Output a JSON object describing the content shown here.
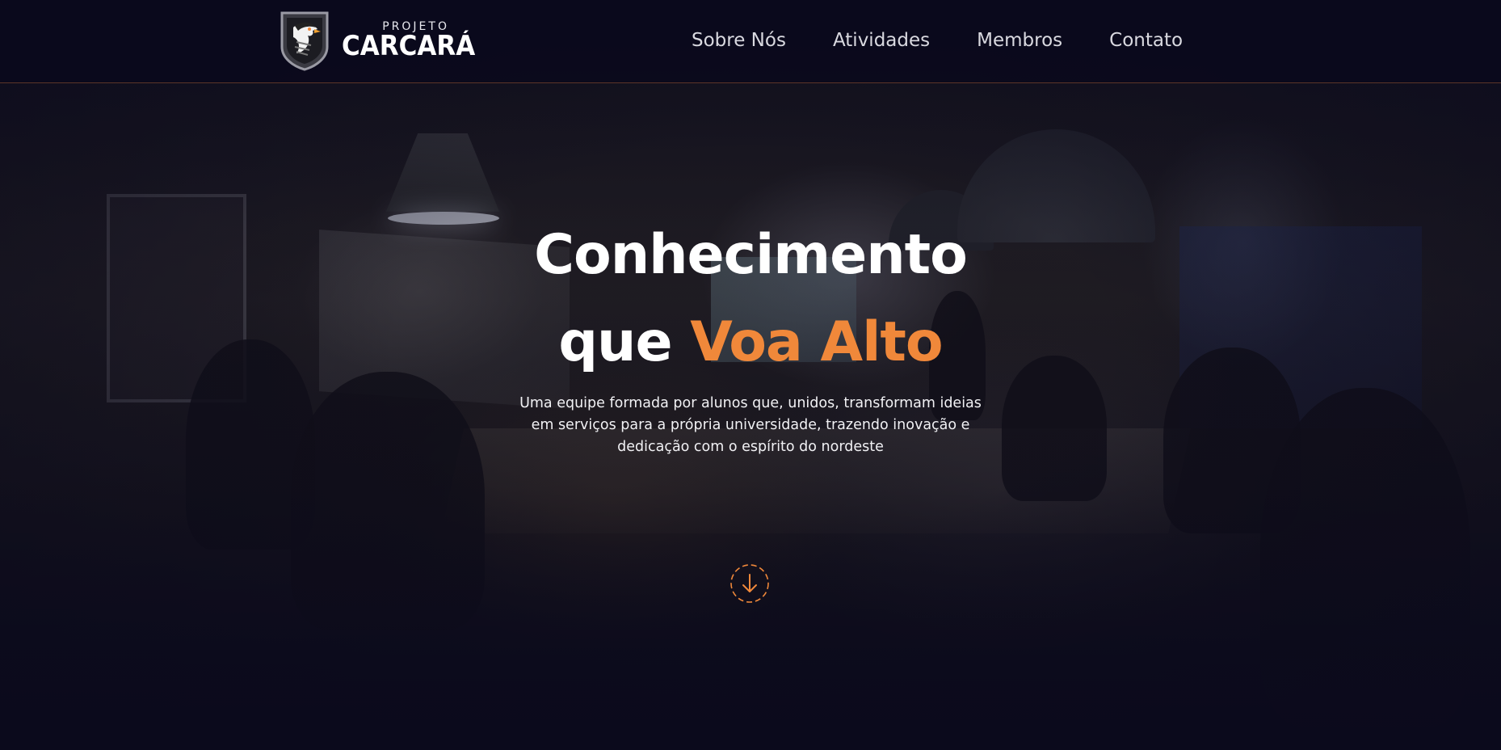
{
  "brand": {
    "small_text": "PROJETO",
    "name": "CARCARÁ",
    "logo_icon": "carcara-shield-icon"
  },
  "nav": {
    "items": [
      {
        "label": "Sobre Nós"
      },
      {
        "label": "Atividades"
      },
      {
        "label": "Membros"
      },
      {
        "label": "Contato"
      }
    ]
  },
  "hero": {
    "title_line1": "Conhecimento",
    "title_line2_plain": "que",
    "title_line2_accent": "Voa Alto",
    "subtitle": "Uma equipe formada por alunos que, unidos, transformam ideias em serviços para a própria universidade, trazendo inovação e dedicação com o espírito do nordeste",
    "scroll_icon": "arrow-down-circle-icon"
  },
  "colors": {
    "accent": "#f0883a",
    "background": "#0b0a1c",
    "text": "#ffffff"
  }
}
